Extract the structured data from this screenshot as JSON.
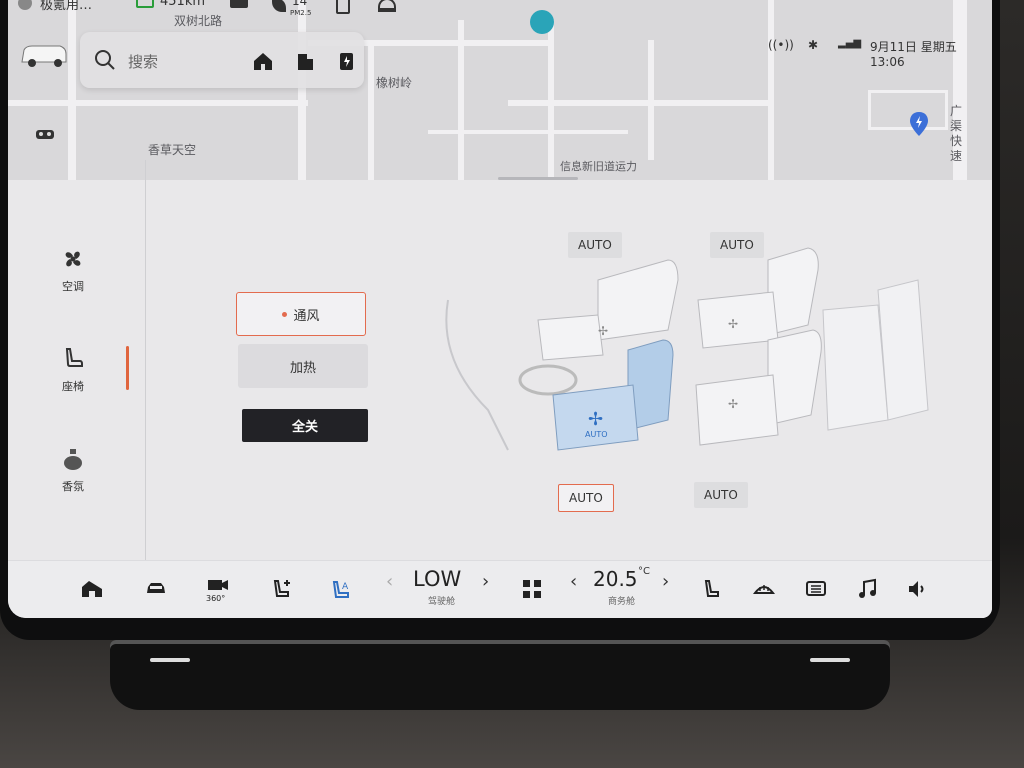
{
  "status_bar": {
    "nav_text": "极氪用…",
    "range": "451km",
    "pm_value": "14",
    "pm_label": "PM2.5",
    "datetime": "9月11日 星期五 13:06"
  },
  "map": {
    "search_placeholder": "搜索",
    "labels": [
      "双树北路",
      "橡树岭",
      "香草天空",
      "信息新旧道运力",
      "广渠快速"
    ]
  },
  "left_nav": {
    "items": [
      {
        "label": "空调",
        "icon": "fan-icon"
      },
      {
        "label": "座椅",
        "icon": "seat-icon"
      },
      {
        "label": "香氛",
        "icon": "fragrance-icon"
      }
    ],
    "active": "座椅"
  },
  "seat_panel": {
    "modes": {
      "vent": "通风",
      "heat": "加热",
      "all_off": "全关"
    },
    "selected_mode": "通风",
    "seat_tags": {
      "front_left": "AUTO",
      "rear_left": "AUTO",
      "front_right": "AUTO",
      "rear_right": "AUTO",
      "seat_badge": "AUTO"
    },
    "selected_seat": "front_right"
  },
  "bottom_bar": {
    "fan": {
      "value": "LOW",
      "label": "驾驶舱"
    },
    "temp": {
      "value": "20.5",
      "unit": "°C",
      "label": "商务舱"
    },
    "view_360": "360°"
  },
  "colors": {
    "accent": "#e36b4e",
    "seat_selected": "#a8c6e6",
    "seat_icon_blue": "#2f6fc2"
  }
}
